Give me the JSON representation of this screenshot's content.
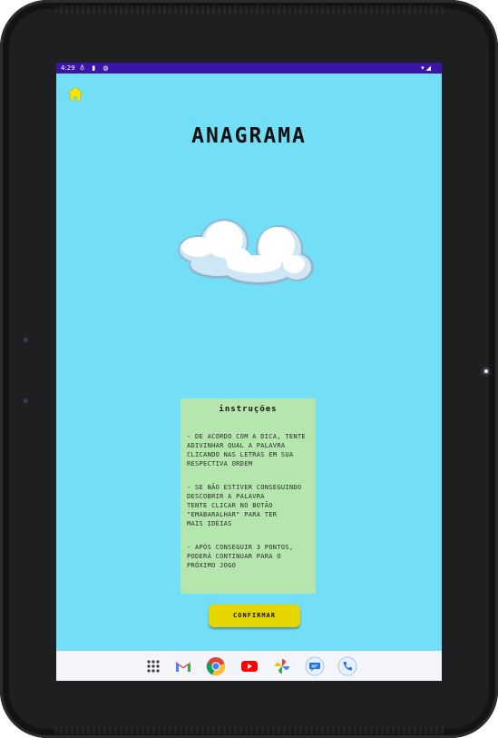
{
  "statusbar": {
    "time": "4:29",
    "left_icons": "♁ ▮ ◍",
    "right_icons": "▾◢"
  },
  "home": {
    "icon": "home-icon",
    "color": "#ffe600"
  },
  "page": {
    "title": "ANAGRAMA",
    "background": "#72dff7"
  },
  "instructions": {
    "title": "instruções",
    "items": [
      "- de acordo com a dica, tente\nadivinhar qual a palavra\nclicando nas letras em sua\nrespectiva ordem",
      "- se não estiver conseguindo\ndescobrir a palavra\ntente clicar no botão\n\"emabaralhar\" para ter\nmais idéias",
      "- após conseguir 3 pontos,\npoderá continuar para o\npróximo jogo"
    ],
    "background": "#b4e6ad"
  },
  "confirm_button": {
    "label": "confirmar",
    "color": "#e6d600"
  },
  "dock": {
    "apps": [
      "apps-grid-icon",
      "gmail-icon",
      "chrome-icon",
      "youtube-icon",
      "photos-icon",
      "messages-icon",
      "phone-icon"
    ]
  }
}
